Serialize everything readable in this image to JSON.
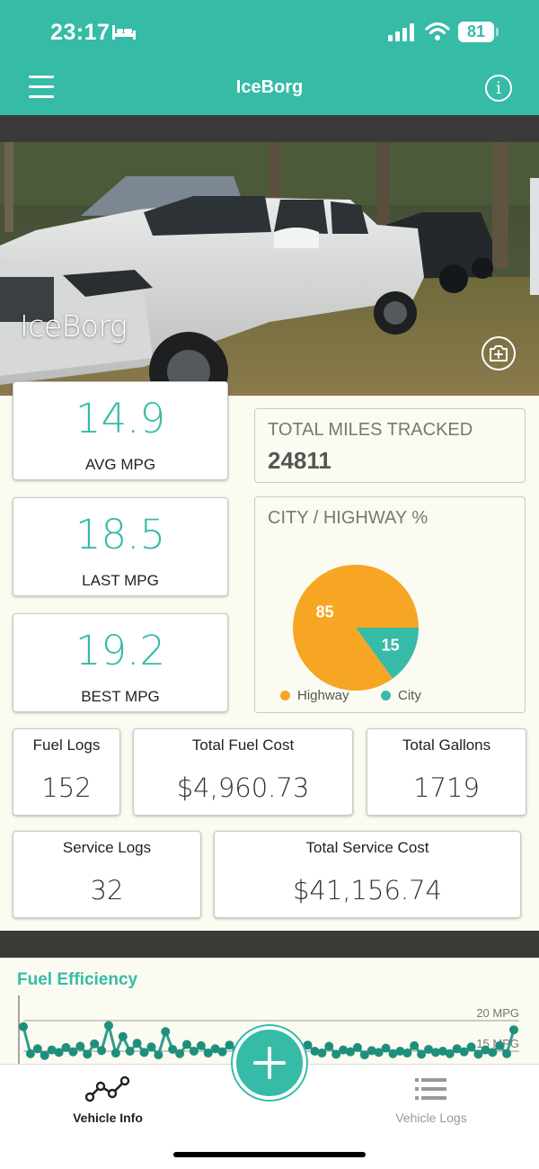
{
  "status_bar": {
    "time": "23:17",
    "battery": "81"
  },
  "header": {
    "title": "IceBorg"
  },
  "vehicle": {
    "name": "IceBorg"
  },
  "mpg_cards": [
    {
      "value": "14.9",
      "label": "AVG MPG"
    },
    {
      "value": "18.5",
      "label": "LAST MPG"
    },
    {
      "value": "19.2",
      "label": "BEST MPG"
    }
  ],
  "miles": {
    "label": "TOTAL MILES TRACKED",
    "value": "24811"
  },
  "city_highway": {
    "label": "CITY / HIGHWAY %",
    "chart_data": {
      "type": "pie",
      "title": "CITY / HIGHWAY %",
      "categories": [
        "Highway",
        "City"
      ],
      "values": [
        85,
        15
      ],
      "colors": [
        "#f6a623",
        "#36bba7"
      ],
      "legend": "bottom"
    }
  },
  "stats": {
    "fuel_logs": {
      "label": "Fuel Logs",
      "value": "152"
    },
    "total_fuel_cost": {
      "label": "Total Fuel Cost",
      "value": "$4,960.73"
    },
    "total_gallons": {
      "label": "Total Gallons",
      "value": "1719"
    },
    "service_logs": {
      "label": "Service Logs",
      "value": "32"
    },
    "total_service_cost": {
      "label": "Total Service Cost",
      "value": "$41,156.74"
    }
  },
  "fuel_efficiency": {
    "title": "Fuel Efficiency",
    "ref_lines": [
      "20 MPG",
      "15 MPG"
    ],
    "chart_data": {
      "type": "line",
      "title": "Fuel Efficiency",
      "ylim": [
        13.5,
        20
      ],
      "values": [
        19.0,
        14.6,
        15.4,
        14.3,
        15.2,
        14.8,
        15.6,
        14.9,
        15.8,
        14.5,
        16.2,
        15.1,
        19.2,
        14.7,
        17.4,
        15.0,
        16.3,
        14.8,
        15.7,
        14.4,
        18.2,
        15.3,
        14.6,
        16.1,
        15.0,
        15.9,
        14.7,
        15.4,
        14.9,
        16.0,
        15.2,
        14.6,
        15.5,
        14.8,
        15.1,
        14.4,
        15.6,
        14.9,
        15.3,
        14.6,
        16.0,
        15.0,
        14.7,
        15.8,
        14.5,
        15.2,
        14.9,
        15.6,
        14.4,
        15.1,
        14.8,
        15.5,
        14.6,
        15.0,
        14.7,
        15.9,
        14.5,
        15.3,
        14.8,
        15.0,
        14.6,
        15.4,
        14.9,
        15.7,
        14.5,
        15.2,
        14.8,
        15.9,
        14.6,
        18.5
      ]
    }
  },
  "nav": {
    "vehicle_info": "Vehicle Info",
    "vehicle_logs": "Vehicle Logs"
  },
  "colors": {
    "accent": "#36bba7",
    "highway": "#f6a623",
    "dark_band": "#3a3b38"
  }
}
